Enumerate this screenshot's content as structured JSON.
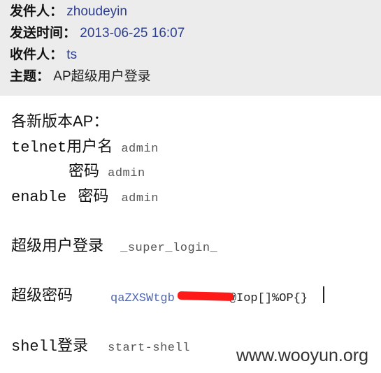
{
  "header": {
    "sender_label": "发件人：",
    "sender_value": "zhoudeyin",
    "time_label": "发送时间：",
    "time_value": "2013-06-25 16:07",
    "to_label": "收件人：",
    "to_value": "ts",
    "subject_label": "主题：",
    "subject_value": "AP超级用户登录"
  },
  "content": {
    "intro": "各新版本AP：",
    "telnet_prefix": "telnet",
    "telnet_label": "用户名",
    "telnet_value": "admin",
    "password_label": "密码",
    "password_value": "admin",
    "enable_prefix": "enable",
    "enable_label": "密码",
    "enable_value": "admin",
    "super_login_label": "超级用户登录",
    "super_login_value": "_super_login_",
    "super_password_label": "超级密码",
    "super_password_start": "qaZXSWtgb",
    "super_password_end": "@Iop[]%OP{}",
    "shell_prefix": "shell",
    "shell_label": "登录",
    "shell_value": "start-shell"
  },
  "watermark": "www.wooyun.org",
  "colors": {
    "header_bg": "#ececec",
    "link_blue": "#2c3f8f",
    "redaction": "#ff1a1a"
  }
}
